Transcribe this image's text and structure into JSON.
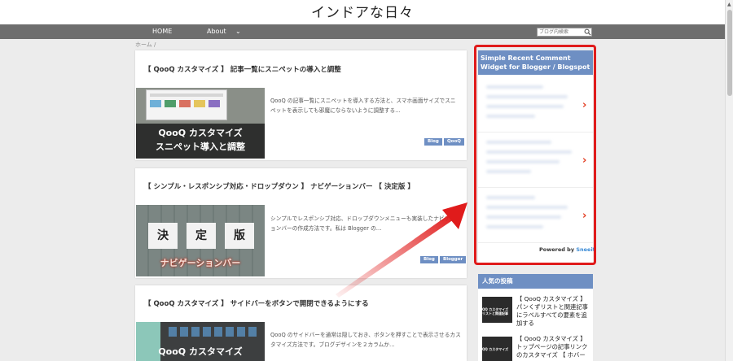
{
  "site": {
    "title": "インドアな日々"
  },
  "nav": {
    "items": [
      {
        "label": "HOME"
      },
      {
        "label": "About"
      }
    ],
    "search_placeholder": "ブログ内検索"
  },
  "breadcrumb": "ホーム /",
  "posts": [
    {
      "title": "【 QooQ カスタマイズ 】 記事一覧にスニペットの導入と調整",
      "thumb_line1": "QooQ カスタマイズ",
      "thumb_line2": "スニペット導入と調整",
      "excerpt": "QooQ の記事一覧にスニペットを導入する方法と、スマホ画面サイズでスニペットを表示しても邪魔にならないように調整する…",
      "tags": [
        "Blog",
        "QooQ"
      ]
    },
    {
      "title": "【 シンプル・レスポンシブ対応・ドロップダウン 】 ナビゲーションバー 【 決定版 】",
      "thumb_cards": [
        "決",
        "定",
        "版"
      ],
      "thumb_line1": "ナビゲーションバー",
      "excerpt": "シンプルでレスポンシブ対応、ドロップダウンメニューも実装したナビゲーションバーの作成方法です。私は Blogger の…",
      "tags": [
        "Blog",
        "Blogger"
      ]
    },
    {
      "title": "【 QooQ カスタマイズ 】 サイドバーをボタンで開閉できるようにする",
      "thumb_line1": "QooQ カスタマイズ",
      "excerpt": "QooQ のサイドバーを通常は隠しておき、ボタンを押すことで表示させるカスタマイズ方法です。ブログデザインを２カラムか…"
    }
  ],
  "widget": {
    "title": "Simple Recent Comment Widget for Blogger / Blogspot",
    "powered_prefix": "Powered by ",
    "powered_brand": "Sneeit"
  },
  "popular": {
    "title": "人気の投稿",
    "items": [
      {
        "thumb_text": "QQ カスタマイズ\nリストと関連記事",
        "text": "【 QooQ カスタマイズ 】 パンくずリストと関連記事にラベルすべての要素を追加する"
      },
      {
        "thumb_text": "QQ カスタマイズ",
        "text": "【 QooQ カスタマイズ 】 トップページの記事リンクのカスタマイズ 【 ホバー"
      }
    ]
  },
  "colors": {
    "accent": "#6e8fc3",
    "nav": "#6e6e6e",
    "highlight": "#e01b1b",
    "chevron": "#e23b1f"
  }
}
